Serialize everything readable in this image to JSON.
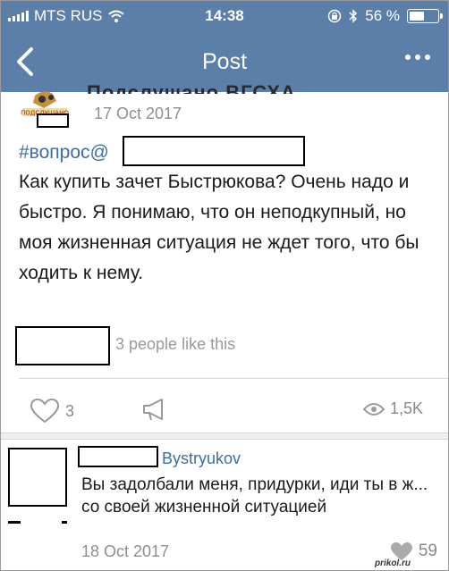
{
  "status": {
    "carrier": "MTS RUS",
    "time": "14:38",
    "battery": "56 %",
    "battery_level": 0.56
  },
  "nav": {
    "title": "Post"
  },
  "post": {
    "author": "Подслушано ВГСХА",
    "date": "17 Oct 2017",
    "hashtag": "#вопрос@",
    "text": "Как купить зачет Быстрюкова? Очень надо и быстро. Я понимаю, что он неподкупный, но моя жизненная ситуация не ждет того, что бы ходить к нему.",
    "likes_summary": "3 people like this",
    "like_count": "3",
    "views": "1,5K"
  },
  "comment": {
    "author": "Bystryukov",
    "text": "Вы задолбали меня, придурки, иди ты в ж... со своей жизненной ситуацией",
    "date": "18 Oct 2017",
    "likes": "59"
  },
  "watermark": "prikol.ru",
  "colors": {
    "header_bg": "#5b7fa8",
    "link": "#3b6ea5",
    "muted": "#8e8e93"
  }
}
